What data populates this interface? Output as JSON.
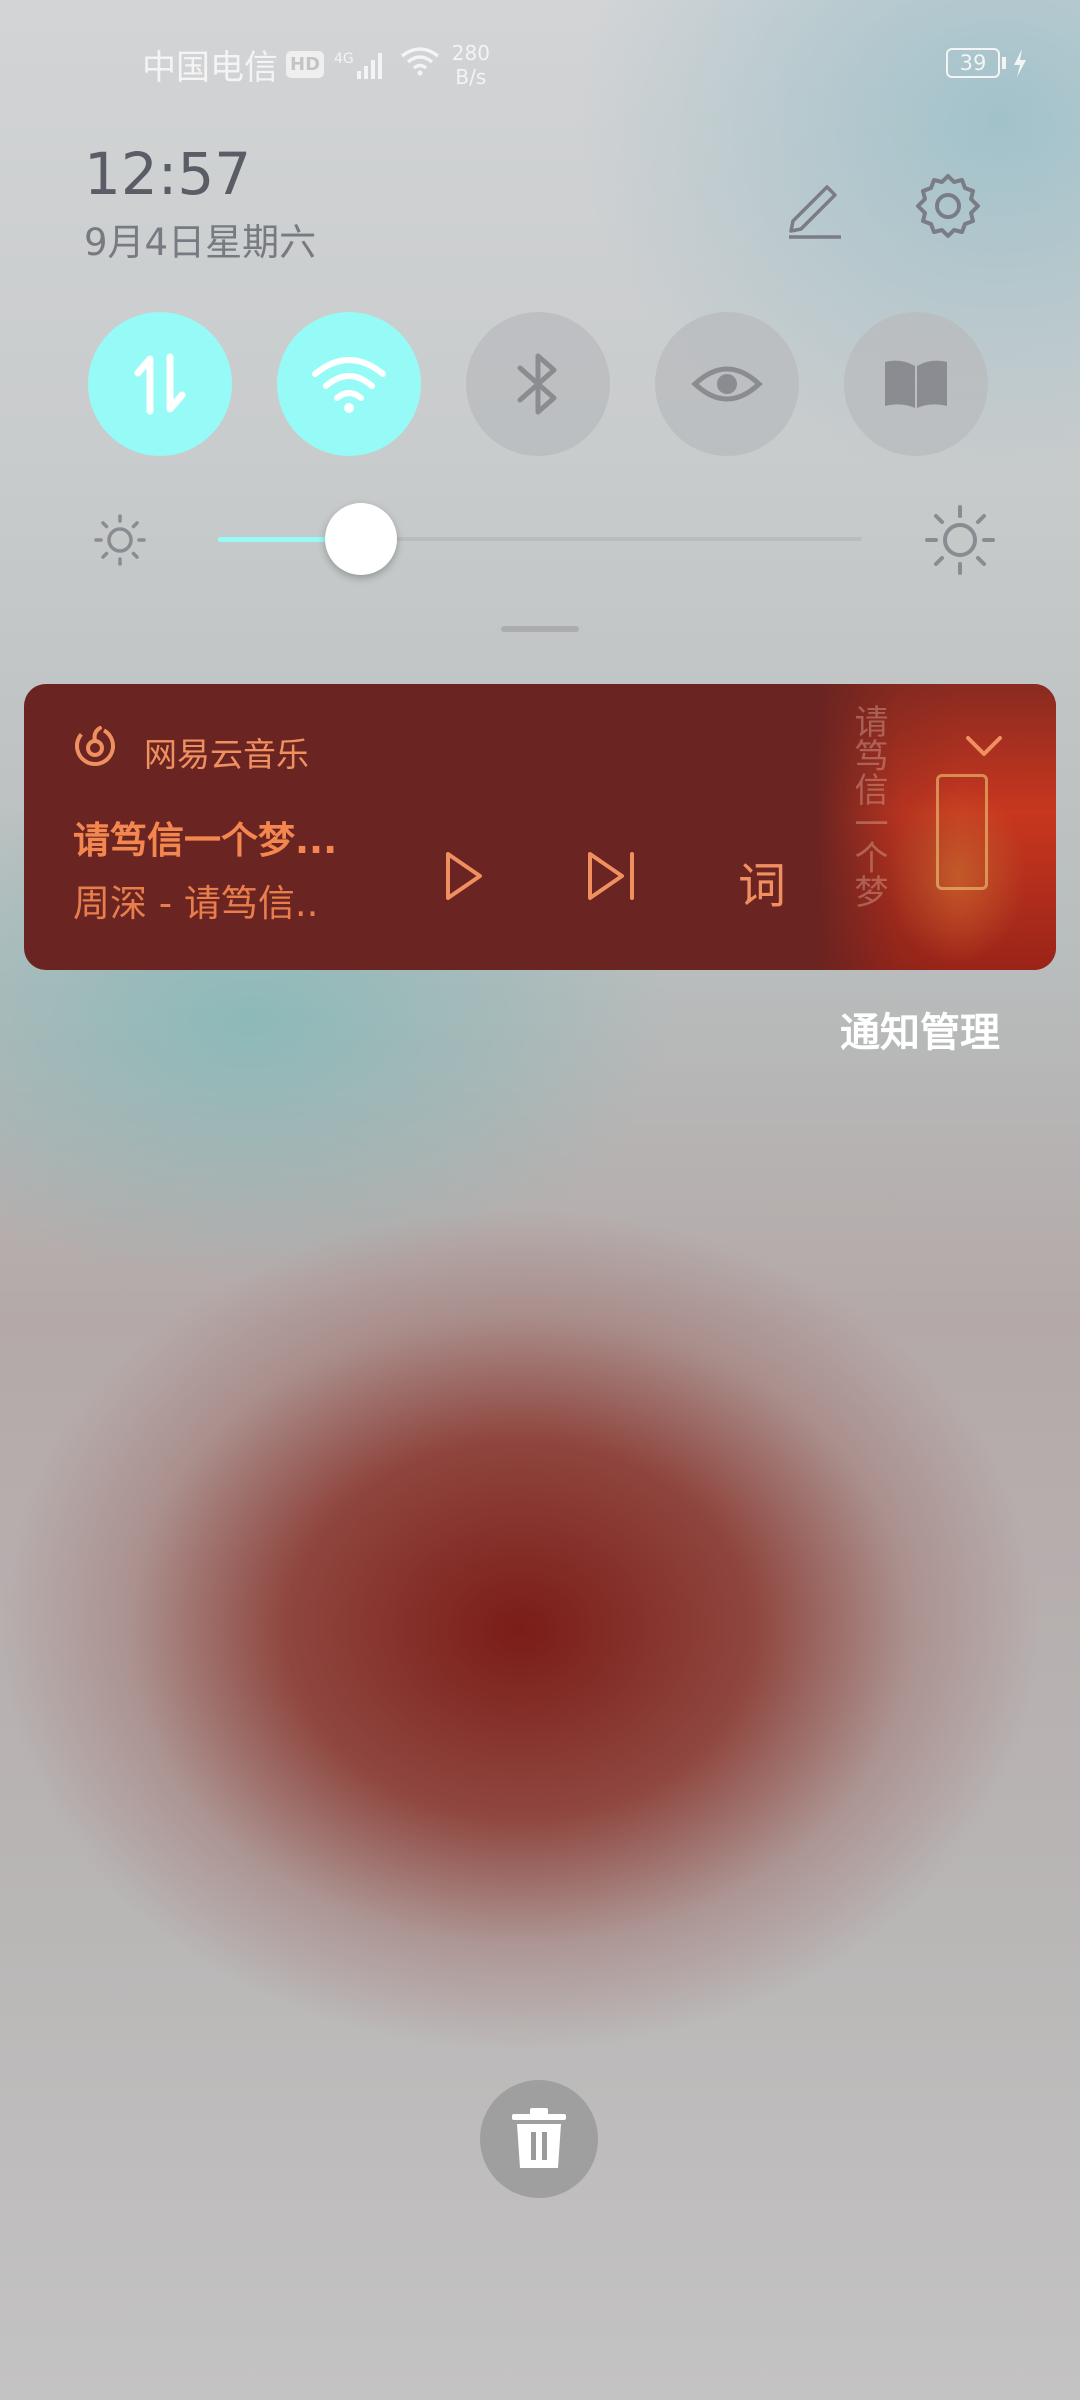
{
  "status_bar": {
    "carrier": "中国电信",
    "hd_badge": "HD",
    "network_type": "4G",
    "speed_value": "280",
    "speed_unit": "B/s",
    "battery_level": "39"
  },
  "header": {
    "time": "12:57",
    "date": "9月4日星期六"
  },
  "quick_toggles": [
    {
      "icon": "data-transfer-icon",
      "state": "on"
    },
    {
      "icon": "wifi-icon",
      "state": "on"
    },
    {
      "icon": "bluetooth-icon",
      "state": "off"
    },
    {
      "icon": "eye-comfort-icon",
      "state": "off"
    },
    {
      "icon": "reading-mode-icon",
      "state": "off"
    }
  ],
  "brightness": {
    "level": 0.22
  },
  "music_notification": {
    "app_name": "网易云音乐",
    "song_title": "请笃信一个梦...",
    "song_artist": "周深 - 请笃信..",
    "lyrics_button": "词",
    "accent_color": "#f4874f",
    "card_color": "#6a2421"
  },
  "notification_management": "通知管理",
  "colors": {
    "toggle_on": "#96fbf6",
    "toggle_off": "#bbbcbe"
  }
}
